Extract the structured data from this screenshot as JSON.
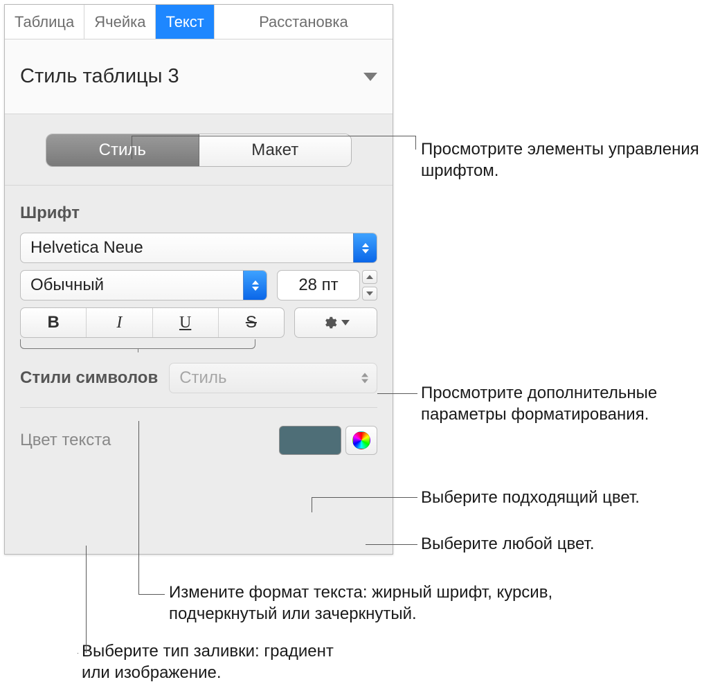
{
  "top_tabs": {
    "table": "Таблица",
    "cell": "Ячейка",
    "text": "Текст",
    "layout": "Расстановка"
  },
  "style_dropdown": {
    "selected": "Стиль таблицы 3"
  },
  "segmented": {
    "style": "Стиль",
    "layout": "Макет"
  },
  "font_section": {
    "label": "Шрифт",
    "family": "Helvetica Neue",
    "weight": "Обычный",
    "size": "28 пт",
    "bold_glyph": "B",
    "italic_glyph": "I",
    "underline_glyph": "U",
    "strike_glyph": "S"
  },
  "char_styles": {
    "label": "Стили символов",
    "placeholder": "Стиль"
  },
  "text_color": {
    "label": "Цвет текста",
    "swatch_hex": "#4e6e77"
  },
  "annotations": {
    "a1": "Просмотрите элементы управления шрифтом.",
    "a2": "Просмотрите дополнительные параметры форматирования.",
    "a3": "Выберите подходящий цвет.",
    "a4": "Выберите любой цвет.",
    "a5": "Измените формат текста: жирный шрифт, курсив, подчеркнутый или зачеркнутый.",
    "a6": "Выберите тип заливки: градиент или изображение."
  }
}
